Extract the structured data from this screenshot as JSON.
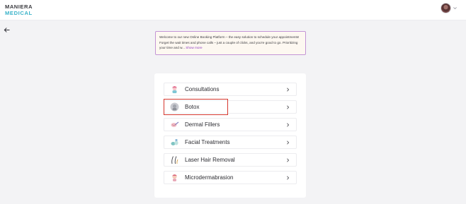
{
  "brand": {
    "line1": "MANIERA",
    "line2": "MEDICAL"
  },
  "header": {
    "avatar_icon": "user-avatar",
    "menu_icon": "chevron-down-icon"
  },
  "nav": {
    "back_icon": "arrow-left-icon"
  },
  "welcome": {
    "text": "Welcome to our new Online Booking Platform – the easy solution to schedule your appointments! Forget the wait times and phone calls – just a couple of clicks, and you're good to go. Prioritizing your time and w...",
    "more_label": "Show more"
  },
  "services": [
    {
      "label": "Consultations",
      "icon": "consultation-icon"
    },
    {
      "label": "Botox",
      "icon": "botox-icon",
      "highlighted": true
    },
    {
      "label": "Dermal Fillers",
      "icon": "dermal-fillers-icon"
    },
    {
      "label": "Facial Treatments",
      "icon": "facial-treatments-icon"
    },
    {
      "label": "Laser Hair Removal",
      "icon": "laser-hair-removal-icon"
    },
    {
      "label": "Microdermabrasion",
      "icon": "microdermabrasion-icon"
    }
  ],
  "colors": {
    "accent": "#9140c0",
    "brand_teal": "#3ab3c9",
    "highlight_border": "#d5372e",
    "welcome_border": "#c395d6"
  }
}
